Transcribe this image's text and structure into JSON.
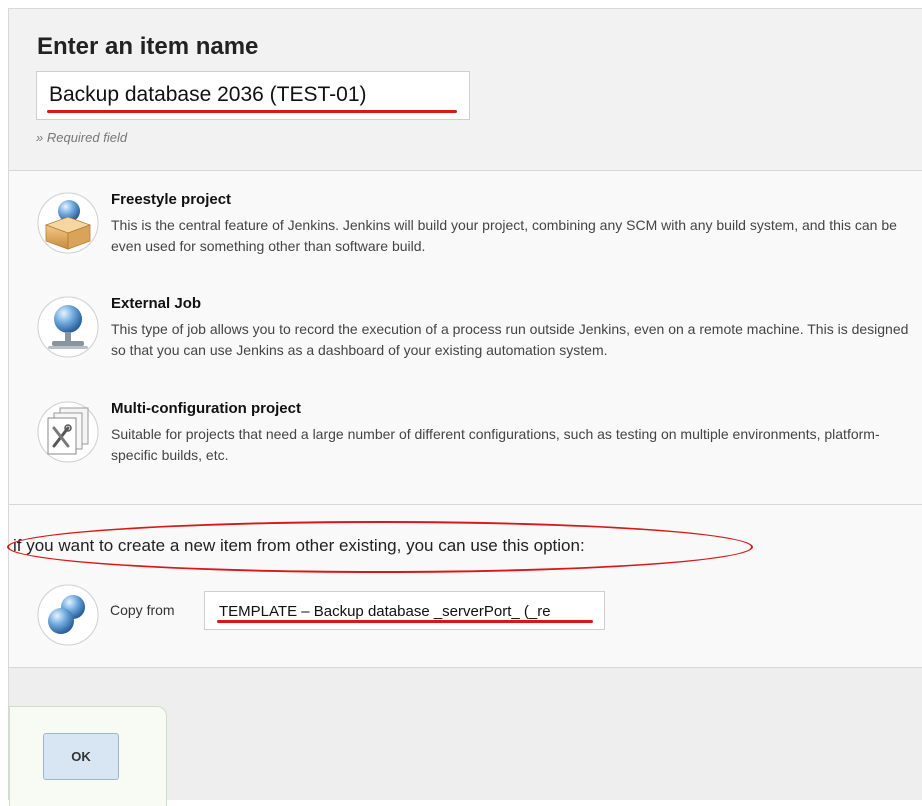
{
  "header": {
    "title": "Enter an item name",
    "item_name": "Backup database 2036 (TEST-01)",
    "required_note": "» Required field"
  },
  "job_types": [
    {
      "title": "Freestyle project",
      "description": "This is the central feature of Jenkins. Jenkins will build your project, combining any SCM with any build system, and this can be even used for something other than software build.",
      "icon": "freestyle-box-icon"
    },
    {
      "title": "External Job",
      "description": "This type of job allows you to record the execution of a process run outside Jenkins, even on a remote machine. This is designed so that you can use Jenkins as a dashboard of your existing automation system.",
      "icon": "external-monitor-icon"
    },
    {
      "title": "Multi-configuration project",
      "description": "Suitable for projects that need a large number of different configurations, such as testing on multiple environments, platform-specific builds, etc.",
      "icon": "multi-config-icon"
    }
  ],
  "copy": {
    "hint": "if you want to create a new item from other existing, you can use this option:",
    "label": "Copy from",
    "value": "TEMPLATE – Backup database _serverPort_ (_re"
  },
  "footer": {
    "ok_label": "OK"
  },
  "colors": {
    "annotation": "#d91717",
    "ok_button": "#d8e6f3"
  }
}
